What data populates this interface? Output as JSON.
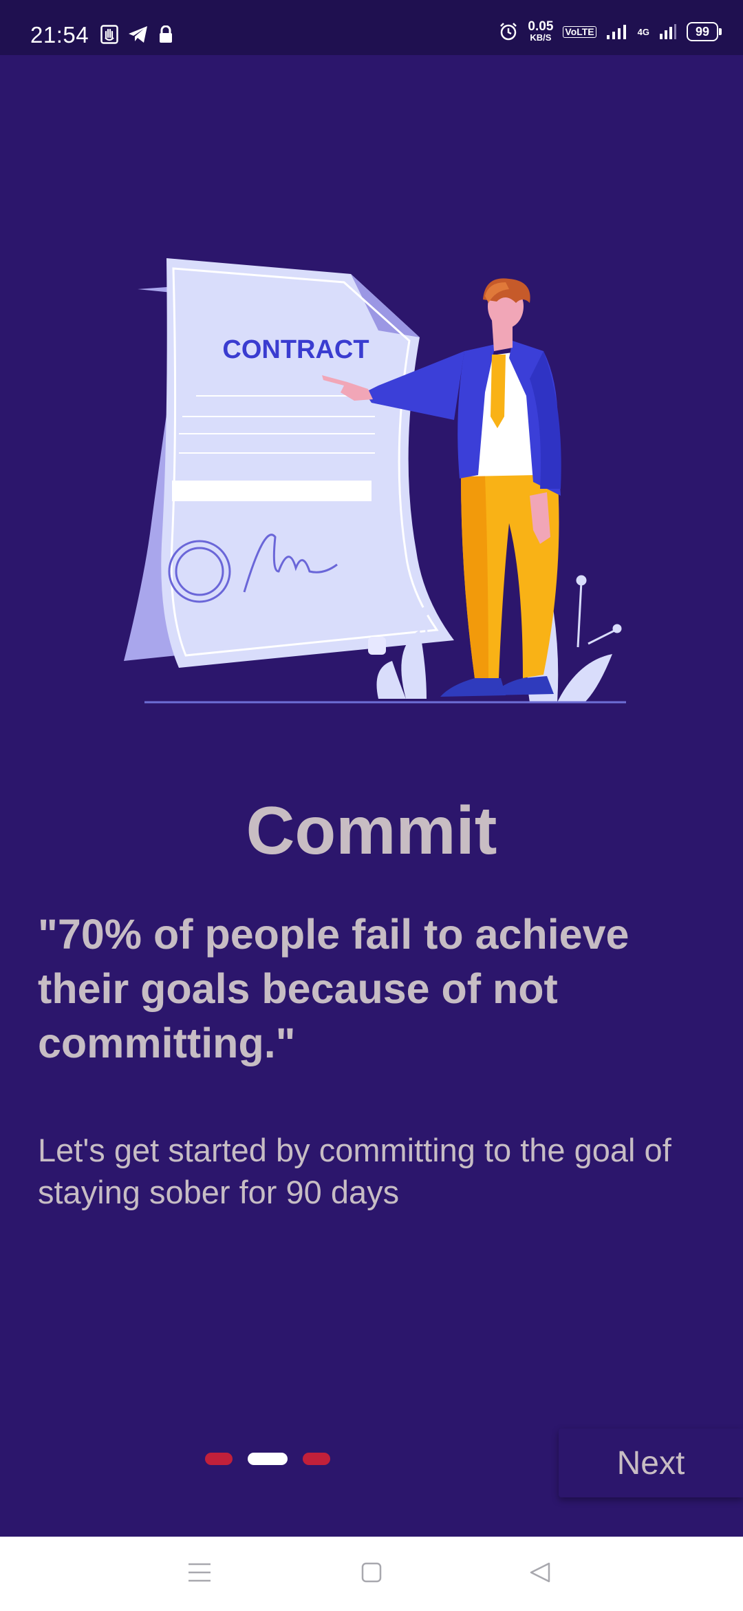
{
  "status_bar": {
    "time": "21:54",
    "speed_value": "0.05",
    "speed_unit": "KB/S",
    "volte": "VoLTE",
    "network": "4G",
    "battery": "99"
  },
  "illustration": {
    "document_title": "CONTRACT"
  },
  "page": {
    "title": "Commit",
    "quote": "\"70% of people fail to achieve their goals because of not committing.\"",
    "description": "Let's get started by committing to the goal of staying sober for 90 days"
  },
  "pager": {
    "count": 3,
    "active_index": 1
  },
  "actions": {
    "next_label": "Next"
  },
  "colors": {
    "background": "#2c166c",
    "status_bar": "#1f1050",
    "text": "#c8bdc3",
    "dot_inactive": "#c2203a",
    "dot_active": "#ffffff"
  },
  "icons": {
    "status_left": [
      "notification-hand-icon",
      "telegram-icon",
      "lock-icon"
    ],
    "status_right": [
      "alarm-icon",
      "signal-icon",
      "battery-icon"
    ],
    "nav": [
      "menu-icon",
      "home-square-icon",
      "back-triangle-icon"
    ]
  }
}
